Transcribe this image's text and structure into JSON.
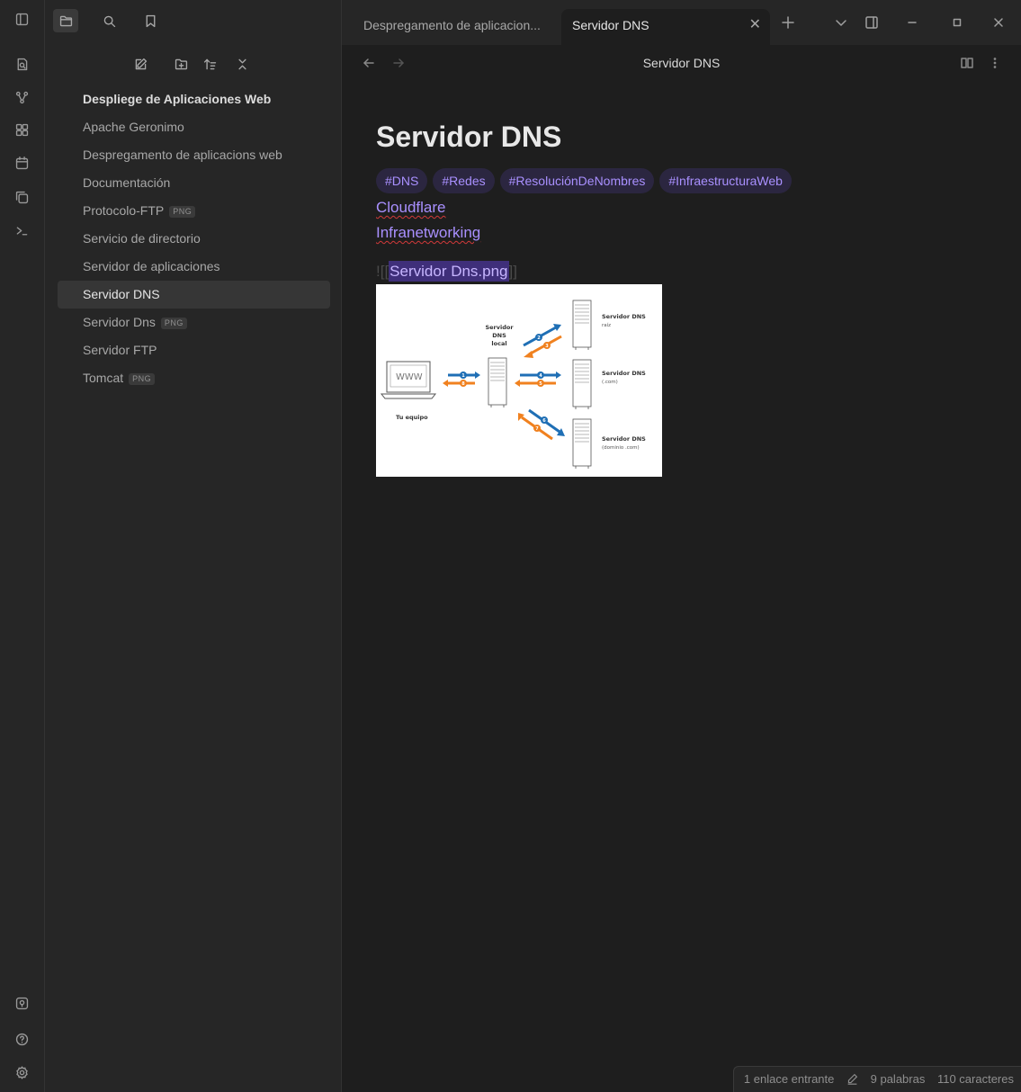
{
  "window": {
    "tabs": [
      {
        "label": "Despregamento de aplicacion..."
      },
      {
        "label": "Servidor DNS"
      }
    ]
  },
  "sidebar": {
    "vault_name": "Despliege de Aplicaciones Web",
    "files": [
      {
        "label": "Apache Geronimo",
        "badge": ""
      },
      {
        "label": "Despregamento de aplicacions web",
        "badge": ""
      },
      {
        "label": "Documentación",
        "badge": ""
      },
      {
        "label": "Protocolo-FTP",
        "badge": "PNG"
      },
      {
        "label": "Servicio de directorio",
        "badge": ""
      },
      {
        "label": "Servidor de aplicaciones",
        "badge": ""
      },
      {
        "label": "Servidor DNS",
        "badge": "",
        "active": true
      },
      {
        "label": "Servidor Dns",
        "badge": "PNG"
      },
      {
        "label": "Servidor FTP",
        "badge": ""
      },
      {
        "label": "Tomcat",
        "badge": "PNG"
      }
    ]
  },
  "view_header": {
    "title": "Servidor DNS"
  },
  "note": {
    "title": "Servidor DNS",
    "tags": [
      "#DNS",
      "#Redes",
      "#ResoluciónDeNombres",
      "#InfraestructuraWeb"
    ],
    "links": [
      "Cloudflare",
      "Infranetworking"
    ],
    "embed": {
      "open": "![[",
      "name": "Servidor Dns.png",
      "close": "]]"
    }
  },
  "diagram": {
    "local_server": [
      "Servidor",
      "DNS",
      "local"
    ],
    "root_server": [
      "Servidor DNS",
      "raíz"
    ],
    "com_server": [
      "Servidor DNS",
      "(.com)"
    ],
    "domain_server": [
      "Servidor DNS",
      "(dominio .com)"
    ],
    "computer": "Tu equipo",
    "www": "WWW",
    "steps": [
      "1",
      "2",
      "3",
      "4",
      "5",
      "6",
      "7",
      "8"
    ],
    "colors": {
      "request": "#1f6fb5",
      "response": "#f0811f"
    }
  },
  "status": {
    "backlinks": "1 enlace entrante",
    "words": "9 palabras",
    "chars": "110 caracteres"
  }
}
